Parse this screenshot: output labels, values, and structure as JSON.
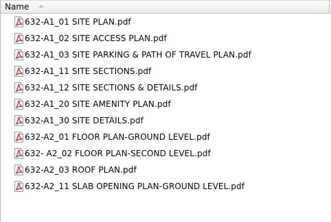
{
  "header": {
    "name_label": "Name"
  },
  "files": [
    {
      "name": "632-A1_01 SITE PLAN.pdf"
    },
    {
      "name": "632-A1_02 SITE ACCESS PLAN.pdf"
    },
    {
      "name": "632-A1_03 SITE PARKING & PATH OF TRAVEL PLAN.pdf"
    },
    {
      "name": "632-A1_11 SITE SECTIONS.pdf"
    },
    {
      "name": "632-A1_12 SITE SECTIONS & DETAILS.pdf"
    },
    {
      "name": "632-A1_20 SITE AMENITY PLAN.pdf"
    },
    {
      "name": "632-A1_30 SITE DETAILS.pdf"
    },
    {
      "name": "632-A2_01 FLOOR PLAN-GROUND LEVEL.pdf"
    },
    {
      "name": "632- A2_02 FLOOR PLAN-SECOND LEVEL.pdf"
    },
    {
      "name": "632-A2_03 ROOF PLAN.pdf"
    },
    {
      "name": "632-A2_11 SLAB OPENING PLAN-GROUND LEVEL.pdf"
    }
  ],
  "icons": {
    "file_icon": "pdf-file-icon",
    "sort_icon": "sort-ascending-icon"
  },
  "colors": {
    "pdf_red": "#d2231f"
  }
}
